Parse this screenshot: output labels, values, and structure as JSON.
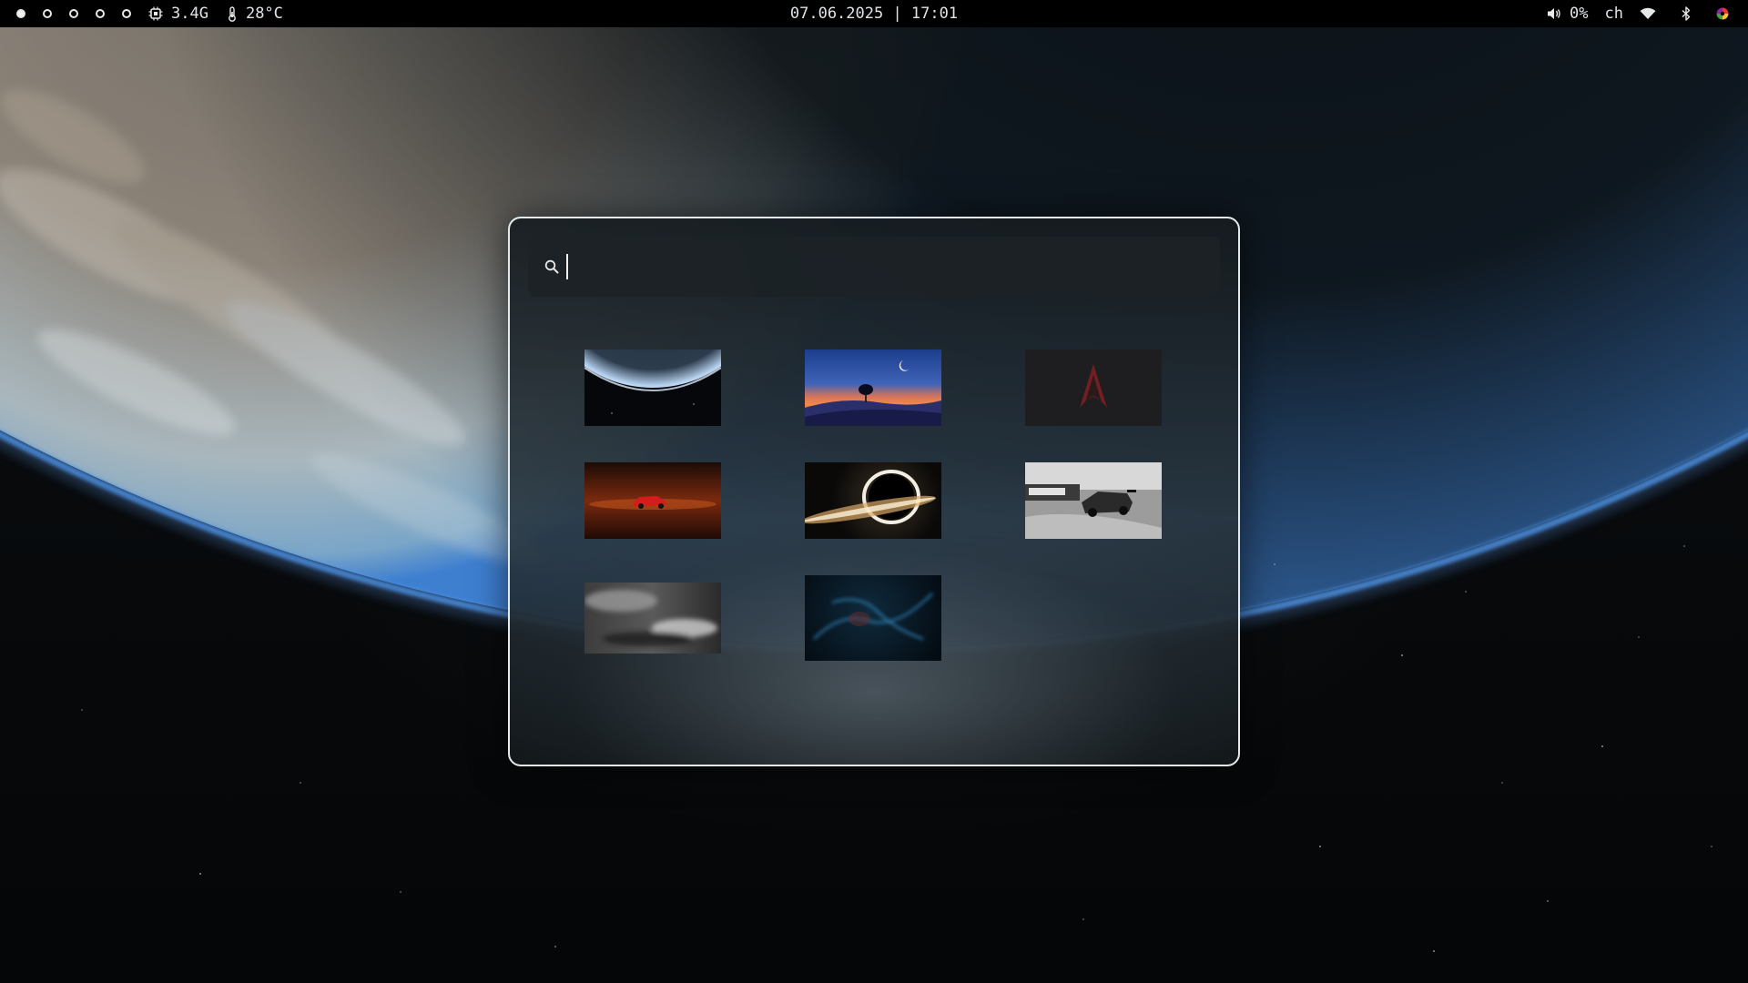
{
  "topbar": {
    "workspaces": [
      {
        "active": true
      },
      {
        "active": false
      },
      {
        "active": false
      },
      {
        "active": false
      },
      {
        "active": false
      }
    ],
    "cpu": {
      "icon": "cpu-icon",
      "value": "3.4G"
    },
    "temp": {
      "icon": "thermometer-icon",
      "value": "28°C"
    },
    "clock": "07.06.2025 | 17:01",
    "volume": {
      "icon": "speaker-icon",
      "value": "0%"
    },
    "keyboard_layout": "ch",
    "wifi_icon": "wifi-icon",
    "bluetooth_icon": "bluetooth-icon",
    "tray_icon": "color-wheel-icon"
  },
  "picker": {
    "search": {
      "placeholder": "",
      "value": ""
    },
    "search_icon": "search-icon",
    "wallpapers": [
      {
        "name": "planet-horizon",
        "icon": "wallpaper-thumbnail"
      },
      {
        "name": "tree-moon-sunset",
        "icon": "wallpaper-thumbnail"
      },
      {
        "name": "arch-logo-dark",
        "icon": "wallpaper-thumbnail"
      },
      {
        "name": "red-car-desert",
        "icon": "wallpaper-thumbnail"
      },
      {
        "name": "black-hole",
        "icon": "wallpaper-thumbnail"
      },
      {
        "name": "race-car-bw",
        "icon": "wallpaper-thumbnail"
      },
      {
        "name": "grey-clouds",
        "icon": "wallpaper-thumbnail"
      },
      {
        "name": "blue-nebula",
        "icon": "wallpaper-thumbnail"
      }
    ]
  },
  "colors": {
    "accent_border": "#e4e9ec",
    "bar_bg": "#000000",
    "atmosphere_blue": "#4a8fe0"
  }
}
